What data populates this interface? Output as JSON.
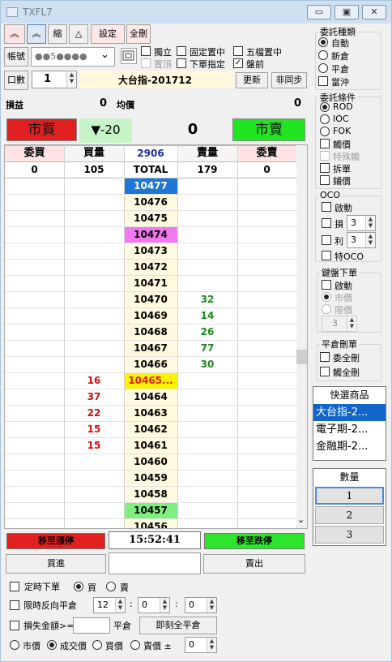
{
  "window": {
    "title": "TXFL7",
    "min": "▭",
    "max": "▣",
    "close": "✕"
  },
  "toolbar": {
    "up1": "︽",
    "up2": "︽",
    "shrink": "縮",
    "tri": "△",
    "settings": "設定",
    "clear": "全刪"
  },
  "account": {
    "label": "帳號",
    "value": "●●5●●●●",
    "chev": "⌄"
  },
  "checks": {
    "independent": "獨立",
    "fixed_mid": "固定置中",
    "five_mid": "五檔置中",
    "set_top": "置頂",
    "below_spec": "下單指定",
    "after_close": "盤前"
  },
  "qty_row": {
    "label": "口數",
    "qty": "1",
    "contract": "大台指-201712",
    "refresh": "更新",
    "unsync": "非同步"
  },
  "summary": {
    "pl_label": "損益",
    "pl": "0",
    "avg_label": "均價",
    "avg": "0"
  },
  "market": {
    "buy": "市買",
    "change": "▼-20",
    "position": "0",
    "sell": "市賣"
  },
  "ladder": {
    "headers": [
      "委買",
      "買量",
      "2906",
      "賣量",
      "委賣"
    ],
    "totals": [
      "0",
      "105",
      "TOTAL",
      "179",
      "0"
    ],
    "rows": [
      {
        "bq": "",
        "p": "10477",
        "sq": "",
        "style": "blue"
      },
      {
        "bq": "",
        "p": "10476",
        "sq": "",
        "style": ""
      },
      {
        "bq": "",
        "p": "10475",
        "sq": "",
        "style": ""
      },
      {
        "bq": "",
        "p": "10474",
        "sq": "",
        "style": "pink"
      },
      {
        "bq": "",
        "p": "10473",
        "sq": "",
        "style": ""
      },
      {
        "bq": "",
        "p": "10472",
        "sq": "",
        "style": ""
      },
      {
        "bq": "",
        "p": "10471",
        "sq": "",
        "style": ""
      },
      {
        "bq": "",
        "p": "10470",
        "sq": "32",
        "style": ""
      },
      {
        "bq": "",
        "p": "10469",
        "sq": "14",
        "style": ""
      },
      {
        "bq": "",
        "p": "10468",
        "sq": "26",
        "style": ""
      },
      {
        "bq": "",
        "p": "10467",
        "sq": "77",
        "style": ""
      },
      {
        "bq": "",
        "p": "10466",
        "sq": "30",
        "style": ""
      },
      {
        "bq": "16",
        "p": "10465...",
        "sq": "",
        "style": "yellow"
      },
      {
        "bq": "37",
        "p": "10464",
        "sq": "",
        "style": ""
      },
      {
        "bq": "22",
        "p": "10463",
        "sq": "",
        "style": ""
      },
      {
        "bq": "15",
        "p": "10462",
        "sq": "",
        "style": ""
      },
      {
        "bq": "15",
        "p": "10461",
        "sq": "",
        "style": ""
      },
      {
        "bq": "",
        "p": "10460",
        "sq": "",
        "style": ""
      },
      {
        "bq": "",
        "p": "10459",
        "sq": "",
        "style": ""
      },
      {
        "bq": "",
        "p": "10458",
        "sq": "",
        "style": ""
      },
      {
        "bq": "",
        "p": "10457",
        "sq": "",
        "style": "green"
      },
      {
        "bq": "",
        "p": "10456",
        "sq": "",
        "style": ""
      }
    ],
    "scroll_down": "⌄"
  },
  "bottom": {
    "to_limit_up": "移至漲停",
    "time": "15:52:41",
    "to_limit_down": "移至跌停",
    "buy_in": "買進",
    "sell_out": "賣出"
  },
  "timed": {
    "label": "定時下單",
    "buy": "買",
    "sell": "賣"
  },
  "reverse": {
    "label": "限時反向平倉",
    "h": "12",
    "m": "0",
    "s": "0"
  },
  "loss": {
    "label": "損失金額>=",
    "close_label": "平倉",
    "close_all_now": "即刻全平倉"
  },
  "price_type": {
    "market": "市價",
    "deal": "成交價",
    "bid": "買價",
    "ask": "賣價 ±",
    "offset": "0"
  },
  "order_type": {
    "title": "委託種類",
    "auto": "自動",
    "new": "新倉",
    "close": "平倉",
    "daytrade": "當沖"
  },
  "order_cond": {
    "title": "委託條件",
    "rod": "ROD",
    "ioc": "IOC",
    "fok": "FOK",
    "touch": "觸價",
    "special": "特殊觸",
    "split": "拆單",
    "spread": "鋪價"
  },
  "oco": {
    "title": "OCO",
    "enable": "啟動",
    "loss": "損",
    "loss_val": "3",
    "profit": "利",
    "profit_val": "3",
    "special": "特OCO"
  },
  "kbd": {
    "title": "鍵盤下單",
    "enable": "啟動",
    "market": "市價",
    "limit": "限價",
    "val": "3"
  },
  "flatdel": {
    "title": "平倉刪單",
    "del_all": "委全刪",
    "flat_all": "觸全刪"
  },
  "quick": {
    "title": "快選商品",
    "items": [
      "大台指-2...",
      "電子期-2...",
      "金融期-2..."
    ]
  },
  "qtybox": {
    "title": "數量",
    "items": [
      "1",
      "2",
      "3"
    ]
  }
}
